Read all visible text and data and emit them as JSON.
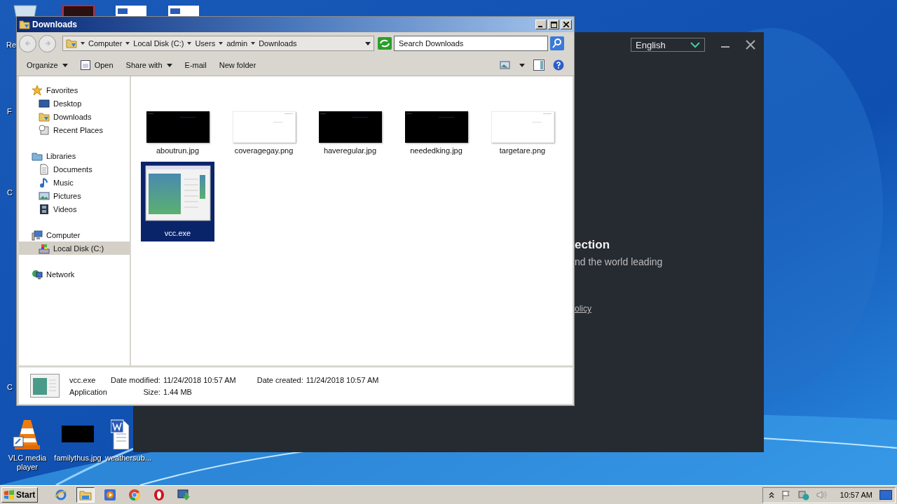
{
  "desktop": {
    "edge_labels": [
      {
        "text": "Re"
      },
      {
        "text": "F"
      },
      {
        "text": "C"
      },
      {
        "text": "C"
      }
    ],
    "icons": [
      {
        "kind": "cone",
        "label": "VLC media player"
      },
      {
        "label": "familythus.jpg"
      },
      {
        "kind": "word",
        "label": "weathersub..."
      }
    ]
  },
  "installer": {
    "language": "English",
    "heading": "ection",
    "text": "nd the world leading",
    "link": "olicy"
  },
  "explorer": {
    "title": "Downloads",
    "breadcrumb": [
      "Computer",
      "Local Disk (C:)",
      "Users",
      "admin",
      "Downloads"
    ],
    "search": {
      "placeholder": "Search Downloads"
    },
    "toolbar": [
      {
        "label": "Organize",
        "kind": "menu"
      },
      {
        "label": "Open",
        "kind": "open"
      },
      {
        "label": "Share with",
        "kind": "menu"
      },
      {
        "label": "E-mail",
        "kind": "plain"
      },
      {
        "label": "New folder",
        "kind": "plain"
      }
    ],
    "nav": [
      {
        "label": "Favorites",
        "kind": "star",
        "selected": false,
        "children": [
          {
            "label": "Desktop",
            "kind": "desktop",
            "selected": false
          },
          {
            "label": "Downloads",
            "kind": "folder",
            "selected": false
          },
          {
            "label": "Recent Places",
            "kind": "recent",
            "selected": false
          }
        ]
      },
      {
        "label": "Libraries",
        "kind": "library",
        "selected": false,
        "children": [
          {
            "label": "Documents",
            "kind": "document",
            "selected": false
          },
          {
            "label": "Music",
            "kind": "music",
            "selected": false
          },
          {
            "label": "Pictures",
            "kind": "pictures",
            "selected": false
          },
          {
            "label": "Videos",
            "kind": "video",
            "selected": false
          }
        ]
      },
      {
        "label": "Computer",
        "kind": "computer",
        "selected": false,
        "children": [
          {
            "label": "Local Disk (C:)",
            "kind": "disk",
            "selected": true
          }
        ]
      },
      {
        "label": "Network",
        "kind": "network",
        "selected": false
      }
    ],
    "files": [
      {
        "name": "aboutrun.jpg",
        "kind": "dark",
        "selected": false
      },
      {
        "name": "coveragegay.png",
        "kind": "light",
        "selected": false
      },
      {
        "name": "haveregular.jpg",
        "kind": "dark",
        "selected": false
      },
      {
        "name": "neededking.jpg",
        "kind": "dark",
        "selected": false
      },
      {
        "name": "targetare.png",
        "kind": "light",
        "selected": false
      },
      {
        "name": "vcc.exe",
        "kind": "app",
        "selected": true
      }
    ],
    "details": {
      "name": "vcc.exe",
      "type": "Application",
      "modified_label": "Date modified:",
      "modified": "11/24/2018 10:57 AM",
      "size_label": "Size:",
      "size": "1.44 MB",
      "created_label": "Date created:",
      "created": "11/24/2018 10:57 AM"
    }
  },
  "taskbar": {
    "start": "Start",
    "apps": [
      {
        "kind": "browser",
        "selected": false
      },
      {
        "kind": "folder",
        "selected": true
      },
      {
        "kind": "player",
        "selected": false
      },
      {
        "kind": "chrome",
        "selected": false
      },
      {
        "kind": "opera",
        "selected": false
      },
      {
        "kind": "installer",
        "selected": false
      }
    ],
    "clock": "10:57 AM"
  }
}
